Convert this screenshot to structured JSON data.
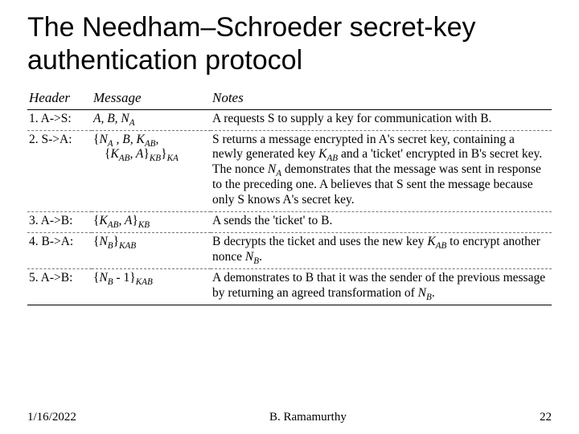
{
  "title": "The Needham–Schroeder secret-key authentication protocol",
  "columns": {
    "header": "Header",
    "message": "Message",
    "notes": "Notes"
  },
  "rows": [
    {
      "header": "1. A->S:",
      "message_html": "<i>A, B, N<sub class=\"s\">A</sub></i>",
      "notes_html": "A requests S to supply a key for communication with B."
    },
    {
      "header": "2. S->A:",
      "message_html": "{<i>N<sub class=\"s\">A</sub> , B, K<sub class=\"s\">AB</sub></i>,<span class=\"l2\">{<i>K<sub class=\"s\">AB</sub>, A</i>}<i><sub class=\"s\">KB</sub></i>}<i><sub class=\"s\">KA</sub></i></span>",
      "notes_html": "S returns a message encrypted in A's secret key, containing a newly generated key <i>K<sub class=\"s\">AB</sub></i> and a 'ticket' encrypted in B's secret key. The nonce <i>N<sub class=\"s\">A</sub></i> demonstrates that the message was sent in response to the preceding one. A believes that S sent the message because only S knows A's secret key."
    },
    {
      "header": "3. A->B:",
      "message_html": "{<i>K<sub class=\"s\">AB</sub>, A</i>}<i><sub class=\"s\">KB</sub></i>",
      "notes_html": "A sends the 'ticket' to B."
    },
    {
      "header": "4. B->A:",
      "message_html": "{<i>N<sub class=\"s\">B</sub></i>}<i><sub class=\"s\">KAB</sub></i>",
      "notes_html": "B decrypts the ticket and uses the new key <i>K<sub class=\"s\">AB</sub></i> to encrypt another nonce <i>N<sub class=\"s\">B</sub></i>."
    },
    {
      "header": "5. A->B:",
      "message_html": "{<i>N<sub class=\"s\">B</sub></i> - 1}<i><sub class=\"s\">KAB</sub></i>",
      "notes_html": "A demonstrates to B that it was the sender of the previous message by returning an agreed transformation of <i>N<sub class=\"s\">B</sub></i>."
    }
  ],
  "footer": {
    "date": "1/16/2022",
    "author": "B. Ramamurthy",
    "page": "22"
  }
}
